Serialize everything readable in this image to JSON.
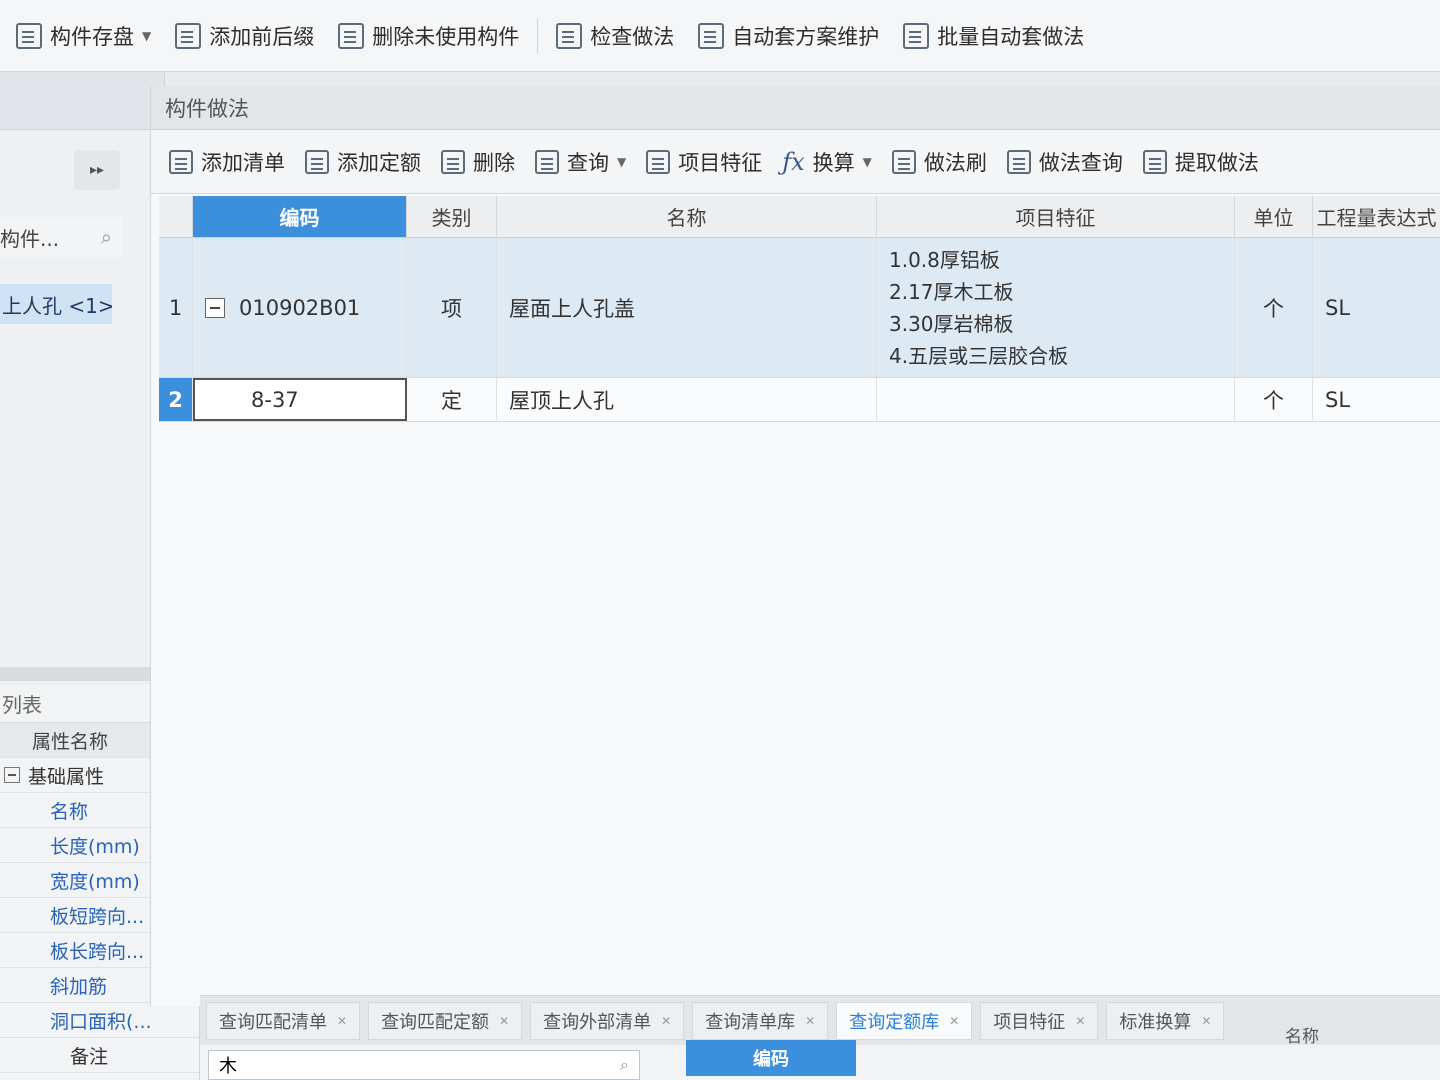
{
  "top_toolbar": {
    "save_component": "构件存盘",
    "add_prefix_suffix": "添加前后缀",
    "delete_unused": "删除未使用构件",
    "check_method": "检查做法",
    "auto_scheme": "自动套方案维护",
    "batch_auto": "批量自动套做法"
  },
  "left_panel": {
    "search_text": "构件...",
    "selected_item": "上人孔 <1>"
  },
  "property_panel": {
    "title": "列表",
    "header": "属性名称",
    "group": "基础属性",
    "items": [
      "名称",
      "长度(mm)",
      "宽度(mm)",
      "板短跨向...",
      "板长跨向...",
      "斜加筋",
      "洞口面积(..."
    ],
    "last_item": "备注"
  },
  "main_panel": {
    "title": "构件做法",
    "toolbar": {
      "add_list": "添加清单",
      "add_quota": "添加定额",
      "delete": "删除",
      "query": "查询",
      "item_features": "项目特征",
      "convert": "换算",
      "method_brush": "做法刷",
      "method_query": "做法查询",
      "extract_method": "提取做法"
    },
    "columns": {
      "code": "编码",
      "type": "类别",
      "name": "名称",
      "features": "项目特征",
      "unit": "单位",
      "expression": "工程量表达式"
    },
    "rows": [
      {
        "idx": "1",
        "code": "010902B01",
        "type": "项",
        "name": "屋面上人孔盖",
        "features": [
          "1.0.8厚铝板",
          "2.17厚木工板",
          "3.30厚岩棉板",
          "4.五层或三层胶合板"
        ],
        "unit": "个",
        "expression": "SL"
      },
      {
        "idx": "2",
        "code": "8-37",
        "type": "定",
        "name": "屋顶上人孔",
        "unit": "个",
        "expression": "SL"
      }
    ]
  },
  "bottom_tabs": [
    "查询匹配清单",
    "查询匹配定额",
    "查询外部清单",
    "查询清单库",
    "查询定额库",
    "项目特征",
    "标准换算"
  ],
  "bottom_search": {
    "value": "木"
  },
  "library": {
    "code_header": "编码",
    "name_header": "名称"
  },
  "colors": {
    "accent": "#3b8fdc",
    "selected_row": "#dde9f3"
  }
}
